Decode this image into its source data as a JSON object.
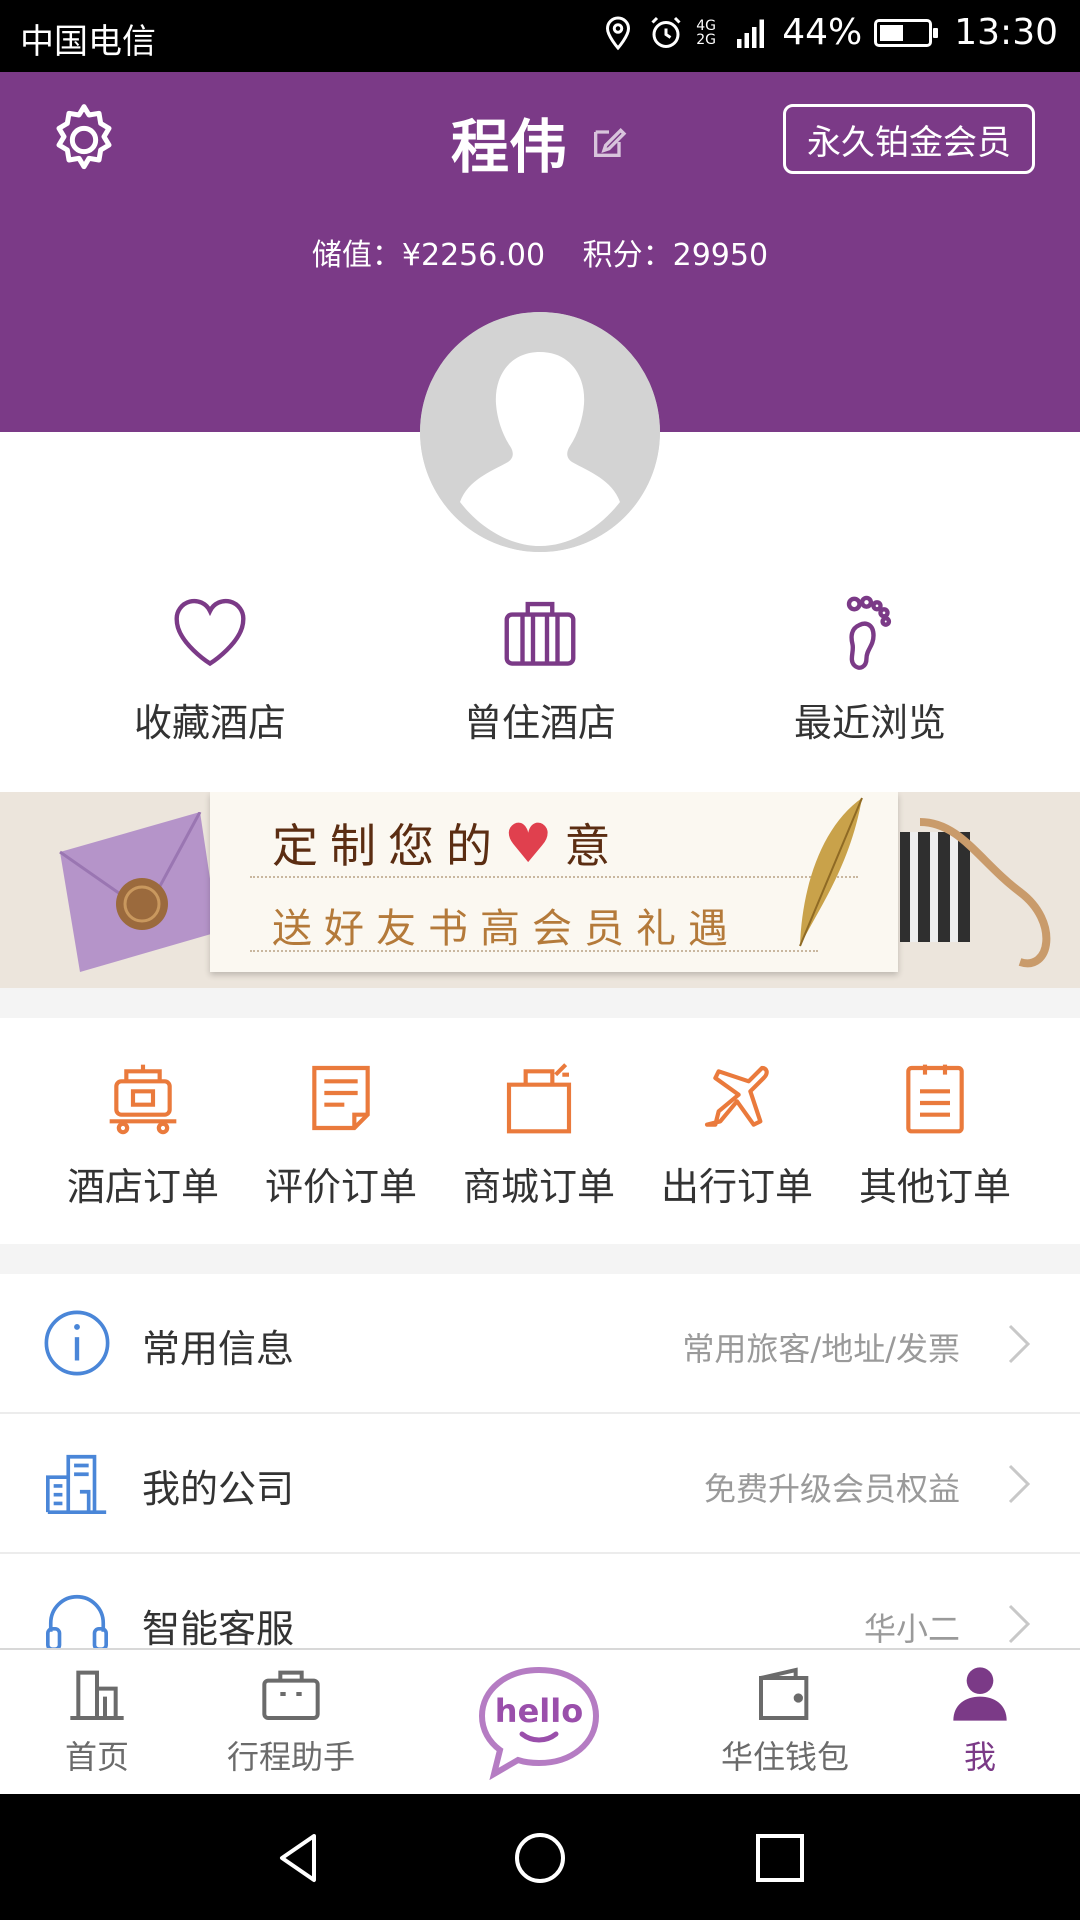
{
  "status_bar": {
    "carrier": "中国电信",
    "network": "4G 2G",
    "battery": "44%",
    "battery_level": 0.44,
    "time": "13:30"
  },
  "header": {
    "username": "程伟",
    "member_level": "永久铂金会员",
    "balance_label": "储值：",
    "balance_value": "¥2256.00",
    "points_label": "积分：",
    "points_value": "29950",
    "colors": {
      "brand": "#7b3a87"
    }
  },
  "quick_links": [
    {
      "label": "收藏酒店",
      "icon": "heart-icon"
    },
    {
      "label": "曾住酒店",
      "icon": "suitcase-icon"
    },
    {
      "label": "最近浏览",
      "icon": "footprint-icon"
    }
  ],
  "banner": {
    "line1_a": "定制您的",
    "line1_b": "意",
    "line2": "送好友书高会员礼遇"
  },
  "orders": [
    {
      "label": "酒店订单",
      "icon": "luggage-cart-icon"
    },
    {
      "label": "评价订单",
      "icon": "review-note-icon"
    },
    {
      "label": "商城订单",
      "icon": "gift-bag-icon"
    },
    {
      "label": "出行订单",
      "icon": "airplane-icon"
    },
    {
      "label": "其他订单",
      "icon": "clipboard-icon"
    }
  ],
  "list": [
    {
      "title": "常用信息",
      "hint": "常用旅客/地址/发票",
      "icon": "info-icon"
    },
    {
      "title": "我的公司",
      "hint": "免费升级会员权益",
      "icon": "company-building-icon"
    },
    {
      "title": "智能客服",
      "hint": "华小二",
      "icon": "headset-icon"
    }
  ],
  "tabbar": {
    "items": [
      {
        "label": "首页",
        "icon": "home-building-icon"
      },
      {
        "label": "行程助手",
        "icon": "briefcase-icon"
      },
      {
        "label": "华住钱包",
        "icon": "wallet-icon"
      },
      {
        "label": "我",
        "icon": "person-icon"
      }
    ],
    "hello_text": "hello",
    "active": "我",
    "colors": {
      "active": "#7b3a87",
      "inactive": "#6b6b6b"
    }
  }
}
